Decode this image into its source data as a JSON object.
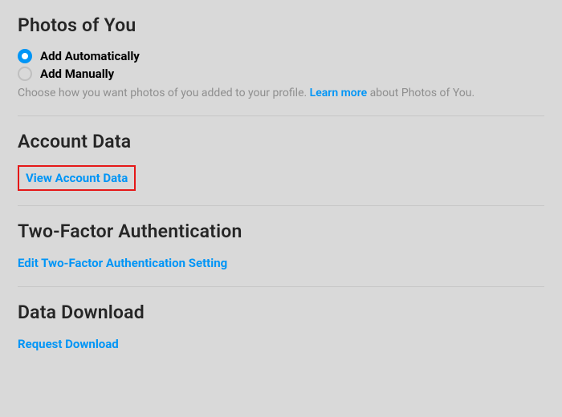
{
  "photos_of_you": {
    "title": "Photos of You",
    "options": {
      "auto": "Add Automatically",
      "manual": "Add Manually"
    },
    "hint_prefix": "Choose how you want photos of you added to your profile. ",
    "hint_link": "Learn more",
    "hint_suffix": " about Photos of You."
  },
  "account_data": {
    "title": "Account Data",
    "link": "View Account Data"
  },
  "two_factor": {
    "title": "Two-Factor Authentication",
    "link": "Edit Two-Factor Authentication Setting"
  },
  "data_download": {
    "title": "Data Download",
    "link": "Request Download"
  }
}
